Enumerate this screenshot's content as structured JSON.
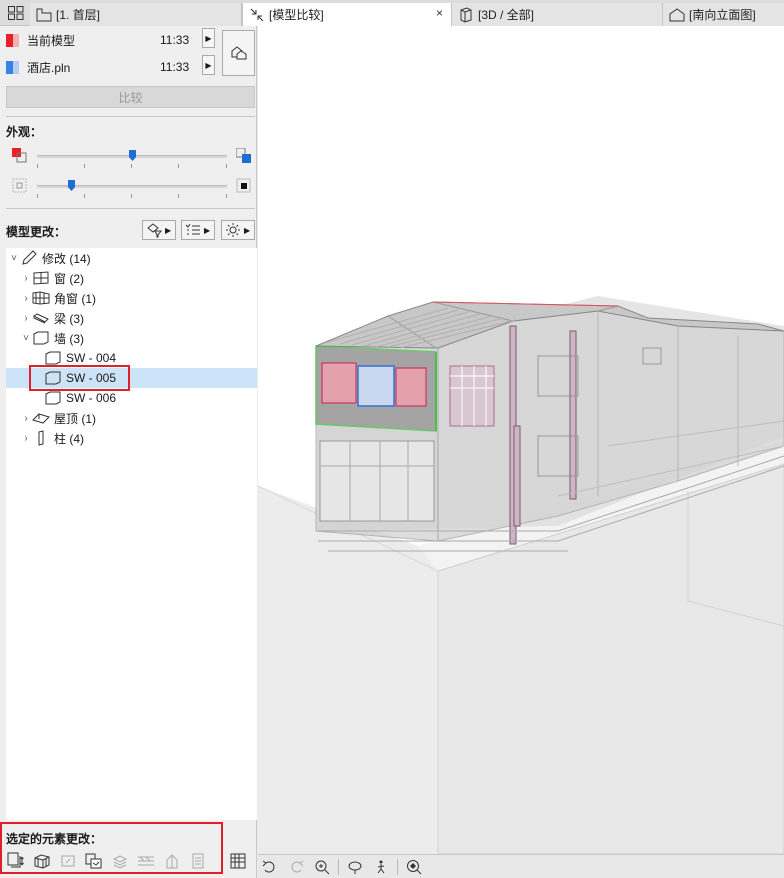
{
  "tabs": [
    {
      "label": "[1. 首层]",
      "active": false
    },
    {
      "label": "[模型比较]",
      "active": true,
      "close": "×"
    },
    {
      "label": "[3D / 全部]",
      "active": false
    },
    {
      "label": "[南向立面图]",
      "active": false
    }
  ],
  "models": [
    {
      "name": "当前模型",
      "time": "11:33",
      "color": "#e8202a"
    },
    {
      "name": "酒店.pln",
      "time": "11:33",
      "color": "#3a82e6"
    }
  ],
  "compare_button": "比较",
  "appearance_label": "外观：",
  "appearance_sliders": [
    {
      "value": 0.5,
      "left_icon": "red-overlay-icon",
      "right_icon": "blue-overlay-icon"
    },
    {
      "value": 0.18,
      "left_icon": "transparent-square-icon",
      "right_icon": "solid-square-icon"
    }
  ],
  "changes_label": "模型更改：",
  "tree": [
    {
      "chev": "˅",
      "label": "修改 (14)",
      "icon": "pencil-icon",
      "indent": 0
    },
    {
      "chev": "›",
      "label": "窗 (2)",
      "icon": "window-icon",
      "indent": 1
    },
    {
      "chev": "›",
      "label": "角窗 (1)",
      "icon": "corner-window-icon",
      "indent": 1
    },
    {
      "chev": "›",
      "label": "梁 (3)",
      "icon": "beam-icon",
      "indent": 1
    },
    {
      "chev": "˅",
      "label": "墙 (3)",
      "icon": "wall-icon",
      "indent": 1
    },
    {
      "chev": "",
      "label": "SW - 004",
      "icon": "wall-icon",
      "indent": 2
    },
    {
      "chev": "",
      "label": "SW - 005",
      "icon": "wall-icon",
      "indent": 2,
      "selected": true
    },
    {
      "chev": "",
      "label": "SW - 006",
      "icon": "wall-icon",
      "indent": 2
    },
    {
      "chev": "›",
      "label": "屋顶 (1)",
      "icon": "roof-icon",
      "indent": 1
    },
    {
      "chev": "›",
      "label": "柱 (4)",
      "icon": "column-icon",
      "indent": 1
    }
  ],
  "selected_changes_label": "选定的元素更改：",
  "accent": "#1d6fd3",
  "highlight": "#e0202a"
}
